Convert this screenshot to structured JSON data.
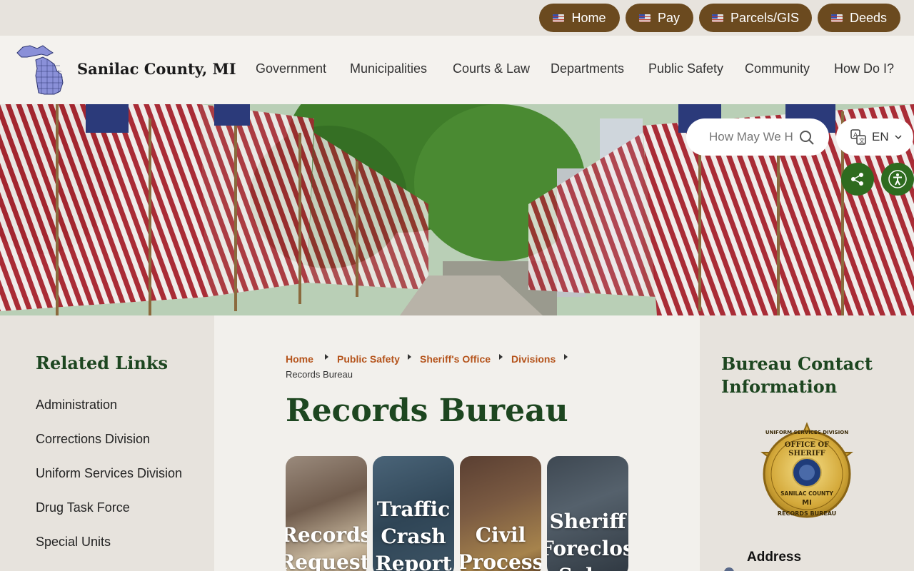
{
  "topbar": {
    "links": [
      {
        "label": "Home"
      },
      {
        "label": "Pay"
      },
      {
        "label": "Parcels/GIS"
      },
      {
        "label": "Deeds"
      }
    ]
  },
  "header": {
    "site_name": "Sanilac County, MI",
    "nav": [
      "Government",
      "Municipalities",
      "Courts & Law",
      "Departments",
      "Public Safety",
      "Community",
      "How Do I?"
    ]
  },
  "hero": {
    "search_placeholder": "How May We Help You?",
    "language": "EN"
  },
  "related_links": {
    "title": "Related Links",
    "items": [
      "Administration",
      "Corrections Division",
      "Uniform Services Division",
      "Drug Task Force",
      "Special Units"
    ]
  },
  "breadcrumb": {
    "items": [
      "Home",
      "Public Safety",
      "Sheriff's Office",
      "Divisions"
    ],
    "current": "Records Bureau"
  },
  "page_title": "Records Bureau",
  "cards": [
    {
      "label": "Records Requests"
    },
    {
      "label": "Traffic Crash Report"
    },
    {
      "label": "Civil Process"
    },
    {
      "label": "Sheriff Foreclosure Sales"
    }
  ],
  "contact": {
    "title": "Bureau Contact Information",
    "badge_text": {
      "top": "UNIFORM SERVICES DIVISION",
      "office": "OFFICE OF",
      "sheriff": "SHERIFF",
      "county": "SANILAC COUNTY",
      "state": "MI",
      "bottom": "RECORDS BUREAU"
    },
    "address_label": "Address"
  },
  "colors": {
    "brown_pill": "#6b4a1f",
    "dark_green": "#1d4620",
    "breadcrumb_orange": "#b5541c",
    "accent_green": "#2e6b1f"
  }
}
